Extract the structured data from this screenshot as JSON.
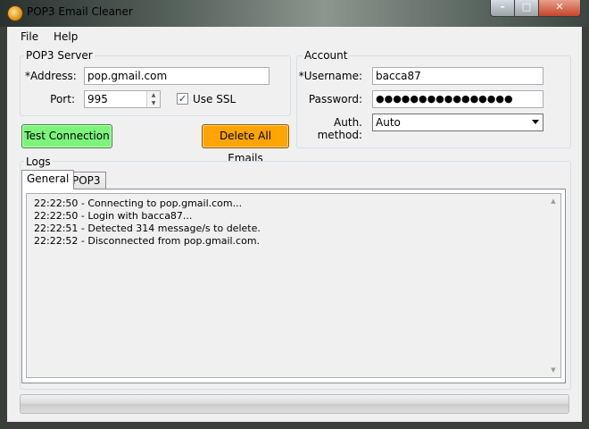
{
  "window": {
    "title": "POP3 Email Cleaner"
  },
  "menu": [
    {
      "label": "File"
    },
    {
      "label": "Help"
    }
  ],
  "pop3_server": {
    "group_label": "POP3 Server",
    "address_label": "*Address:",
    "address_value": "pop.gmail.com",
    "port_label": "Port:",
    "port_value": "995",
    "ssl_label": "Use SSL",
    "ssl_checked": true
  },
  "account": {
    "group_label": "Account",
    "username_label": "*Username:",
    "username_value": "bacca87",
    "password_label": "Password:",
    "password_value": "●●●●●●●●●●●●●●●●",
    "auth_label": "Auth. method:",
    "auth_value": "Auto"
  },
  "buttons": {
    "test": "Test Connection",
    "delete": "Delete All Emails"
  },
  "logs": {
    "group_label": "Logs",
    "tabs": [
      {
        "label": "General"
      },
      {
        "label": "POP3"
      }
    ],
    "lines": [
      "22:22:50 - Connecting to pop.gmail.com...",
      "22:22:50 - Login with bacca87...",
      "22:22:51 - Detected 314 message/s to delete.",
      "22:22:52 - Disconnected from pop.gmail.com."
    ]
  },
  "progress": {
    "value": 0
  },
  "colors": {
    "test_button": "#7cf47c",
    "delete_button": "#ffa400"
  },
  "icons": {
    "app": "mail-cleaner-icon",
    "minimize": "minimize-icon",
    "maximize": "maximize-icon",
    "close": "close-icon"
  }
}
